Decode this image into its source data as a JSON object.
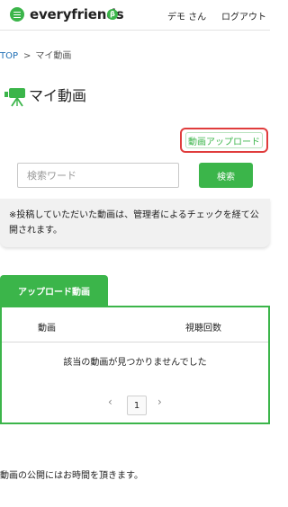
{
  "header": {
    "logo_text": "everyfriends",
    "logo_badge": "β",
    "user_label": "デモ さん",
    "logout_label": "ログアウト"
  },
  "breadcrumb": {
    "top": "TOP",
    "separator": ">",
    "current": "マイ動画"
  },
  "page": {
    "title": "マイ動画",
    "icon": "video-camera-icon"
  },
  "upload_button_label": "動画アップロード",
  "search": {
    "placeholder": "検索ワード",
    "value": "",
    "button_label": "検索"
  },
  "notice_text": "※投稿していただいた動画は、管理者によるチェックを経て公開されます。",
  "tabs": [
    {
      "label": "アップロード動画",
      "active": true
    }
  ],
  "table": {
    "columns": [
      "動画",
      "視聴回数"
    ],
    "empty_message": "該当の動画が見つかりませんでした"
  },
  "pagination": {
    "prev": "‹",
    "current": "1",
    "next": "›"
  },
  "footer_note": "動画の公開にはお時間を頂きます。",
  "colors": {
    "accent_green": "#3bb54a",
    "highlight_red": "#e03c3c",
    "link_blue": "#1f6fb5"
  }
}
